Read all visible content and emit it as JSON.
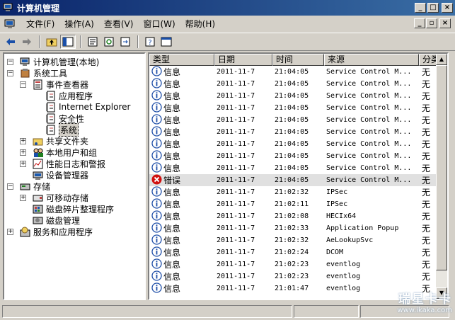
{
  "window": {
    "title": "计算机管理",
    "minimize": "_",
    "maximize": "□",
    "close": "×",
    "restore": "▫"
  },
  "menu": [
    {
      "label": "文件(F)"
    },
    {
      "label": "操作(A)"
    },
    {
      "label": "查看(V)"
    },
    {
      "label": "窗口(W)"
    },
    {
      "label": "帮助(H)"
    }
  ],
  "toolbar": {
    "icons": [
      "back-arrow-icon",
      "forward-arrow-icon",
      "up-folder-icon",
      "show-hide-tree-icon",
      "properties-icon",
      "refresh-icon",
      "export-list-icon",
      "help-icon",
      "console-icon"
    ]
  },
  "tree": {
    "items": [
      {
        "label": "计算机管理(本地)",
        "icon": "computer-management-icon"
      },
      {
        "label": "系统工具",
        "icon": "system-tools-icon"
      },
      {
        "label": "事件查看器",
        "icon": "event-viewer-icon"
      },
      {
        "label": "应用程序",
        "icon": "log-icon"
      },
      {
        "label": "Internet Explorer",
        "icon": "log-icon"
      },
      {
        "label": "安全性",
        "icon": "log-icon"
      },
      {
        "label": "系统",
        "icon": "log-icon"
      },
      {
        "label": "共享文件夹",
        "icon": "shared-folder-icon"
      },
      {
        "label": "本地用户和组",
        "icon": "users-icon"
      },
      {
        "label": "性能日志和警报",
        "icon": "performance-icon"
      },
      {
        "label": "设备管理器",
        "icon": "device-manager-icon"
      },
      {
        "label": "存储",
        "icon": "storage-icon"
      },
      {
        "label": "可移动存储",
        "icon": "removable-storage-icon"
      },
      {
        "label": "磁盘碎片整理程序",
        "icon": "defrag-icon"
      },
      {
        "label": "磁盘管理",
        "icon": "disk-management-icon"
      },
      {
        "label": "服务和应用程序",
        "icon": "services-icon"
      }
    ]
  },
  "list": {
    "columns": [
      "类型",
      "日期",
      "时间",
      "来源",
      "分类"
    ],
    "rows": [
      {
        "type": "信息",
        "date": "2011-11-7",
        "time": "21:04:05",
        "source": "Service Control M...",
        "category": "无"
      },
      {
        "type": "信息",
        "date": "2011-11-7",
        "time": "21:04:05",
        "source": "Service Control M...",
        "category": "无"
      },
      {
        "type": "信息",
        "date": "2011-11-7",
        "time": "21:04:05",
        "source": "Service Control M...",
        "category": "无"
      },
      {
        "type": "信息",
        "date": "2011-11-7",
        "time": "21:04:05",
        "source": "Service Control M...",
        "category": "无"
      },
      {
        "type": "信息",
        "date": "2011-11-7",
        "time": "21:04:05",
        "source": "Service Control M...",
        "category": "无"
      },
      {
        "type": "信息",
        "date": "2011-11-7",
        "time": "21:04:05",
        "source": "Service Control M...",
        "category": "无"
      },
      {
        "type": "信息",
        "date": "2011-11-7",
        "time": "21:04:05",
        "source": "Service Control M...",
        "category": "无"
      },
      {
        "type": "信息",
        "date": "2011-11-7",
        "time": "21:04:05",
        "source": "Service Control M...",
        "category": "无"
      },
      {
        "type": "信息",
        "date": "2011-11-7",
        "time": "21:04:05",
        "source": "Service Control M...",
        "category": "无"
      },
      {
        "type": "错误",
        "date": "2011-11-7",
        "time": "21:04:05",
        "source": "Service Control M...",
        "category": "无",
        "error": true
      },
      {
        "type": "信息",
        "date": "2011-11-7",
        "time": "21:02:32",
        "source": "IPSec",
        "category": "无"
      },
      {
        "type": "信息",
        "date": "2011-11-7",
        "time": "21:02:11",
        "source": "IPSec",
        "category": "无"
      },
      {
        "type": "信息",
        "date": "2011-11-7",
        "time": "21:02:08",
        "source": "HECIx64",
        "category": "无"
      },
      {
        "type": "信息",
        "date": "2011-11-7",
        "time": "21:02:33",
        "source": "Application Popup",
        "category": "无"
      },
      {
        "type": "信息",
        "date": "2011-11-7",
        "time": "21:02:32",
        "source": "AeLookupSvc",
        "category": "无"
      },
      {
        "type": "信息",
        "date": "2011-11-7",
        "time": "21:02:24",
        "source": "DCOM",
        "category": "无"
      },
      {
        "type": "信息",
        "date": "2011-11-7",
        "time": "21:02:23",
        "source": "eventlog",
        "category": "无"
      },
      {
        "type": "信息",
        "date": "2011-11-7",
        "time": "21:02:23",
        "source": "eventlog",
        "category": "无"
      },
      {
        "type": "信息",
        "date": "2011-11-7",
        "time": "21:01:47",
        "source": "eventlog",
        "category": "无"
      }
    ]
  },
  "watermark": {
    "line1": "瑞星卡卡",
    "line2": "www.ikaka.com"
  },
  "colors": {
    "titlebar": "#0a246a",
    "info": "#1f4fa8",
    "error": "#d01010",
    "chrome": "#d4d0c8"
  }
}
